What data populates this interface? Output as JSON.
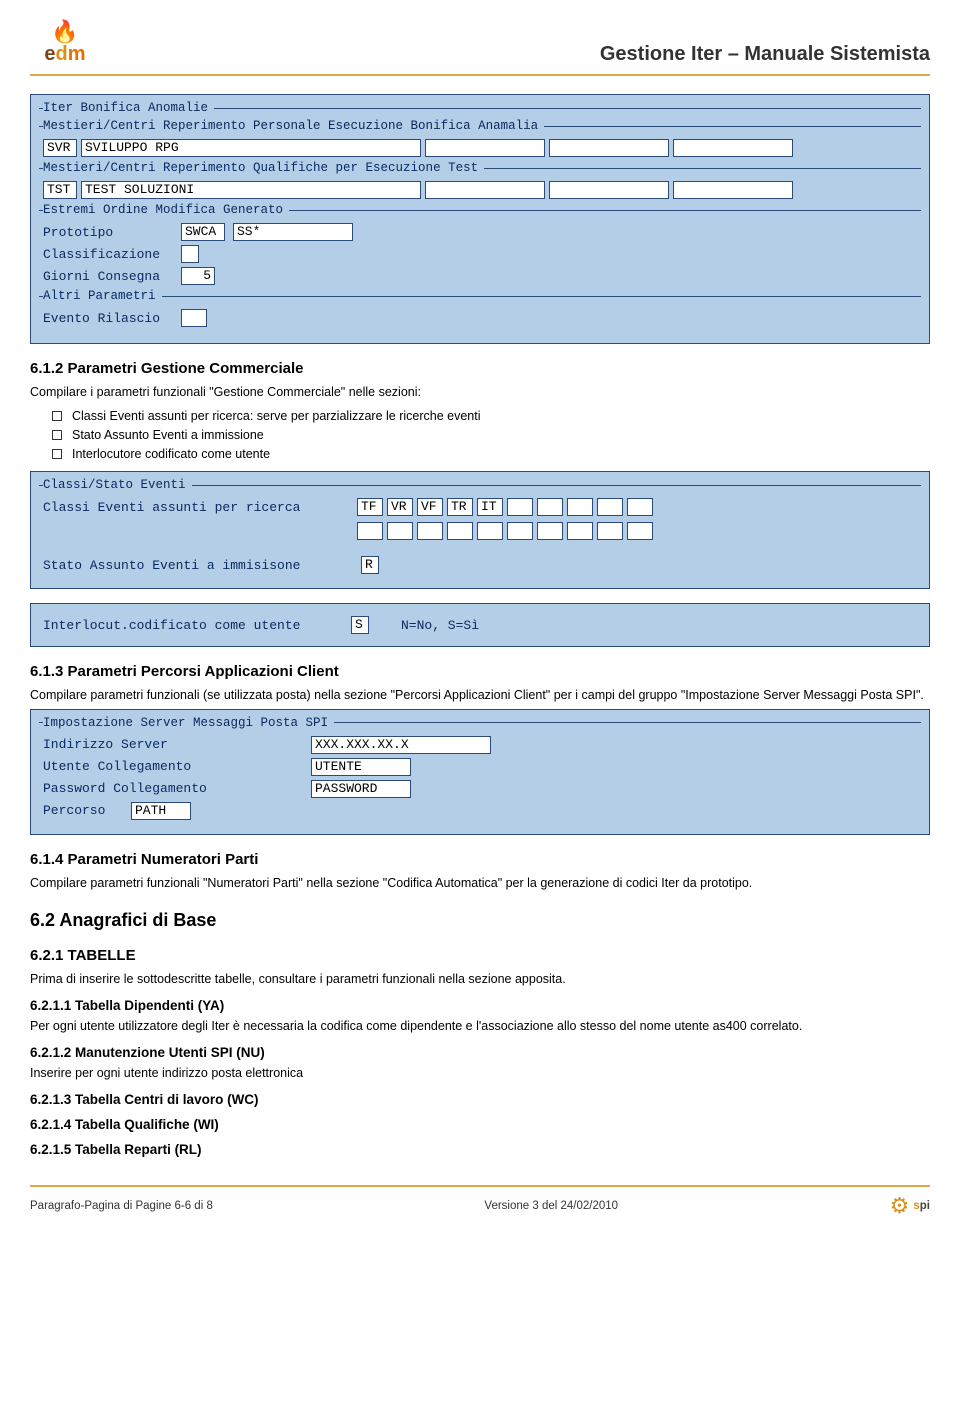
{
  "header": {
    "doc_title": "Gestione Iter – Manuale Sistemista",
    "logo_e": "e",
    "logo_d": "d",
    "logo_m": "m"
  },
  "panel1": {
    "title": "Iter Bonifica Anomalie",
    "g1_legend": "Mestieri/Centri Reperimento Personale Esecuzione Bonifica Anamalia",
    "g1_code": "SVR",
    "g1_desc": "SVILUPPO RPG",
    "g2_legend": "Mestieri/Centri Reperimento Qualifiche per Esecuzione Test",
    "g2_code": "TST",
    "g2_desc": "TEST SOLUZIONI",
    "g3_legend": "Estremi Ordine Modifica Generato",
    "g3_proto_lbl": "Prototipo",
    "g3_proto_val1": "SWCA",
    "g3_proto_val2": "SS*",
    "g3_class_lbl": "Classificazione",
    "g3_days_lbl": "Giorni Consegna",
    "g3_days_val": "5",
    "g4_legend": "Altri Parametri",
    "g4_evt_lbl": "Evento Rilascio"
  },
  "s612": {
    "heading": "6.1.2  Parametri Gestione Commerciale",
    "intro": "Compilare i parametri funzionali \"Gestione Commerciale\" nelle sezioni:",
    "b1": "Classi Eventi assunti per ricerca: serve per parzializzare le ricerche eventi",
    "b2": "Stato Assunto Eventi a immissione",
    "b3": "Interlocutore codificato come utente"
  },
  "panel2": {
    "title": "Classi/Stato Eventi",
    "row1_lbl": "Classi Eventi assunti per ricerca",
    "row1_v1": "TF",
    "row1_v2": "VR",
    "row1_v3": "VF",
    "row1_v4": "TR",
    "row1_v5": "IT",
    "row2_lbl": "Stato Assunto Eventi a immisisone",
    "row2_v": "R"
  },
  "panel3": {
    "lbl": "Interlocut.codificato come utente",
    "val": "S",
    "hint": "N=No, S=Sì"
  },
  "s613": {
    "heading": "6.1.3  Parametri Percorsi Applicazioni Client",
    "body": "Compilare parametri funzionali (se utilizzata posta) nella sezione \"Percorsi Applicazioni Client\" per i campi del gruppo \"Impostazione Server Messaggi Posta SPI\"."
  },
  "panel4": {
    "title": "Impostazione Server Messaggi Posta SPI",
    "r1_lbl": "Indirizzo Server",
    "r1_val": "XXX.XXX.XX.X",
    "r2_lbl": "Utente Collegamento",
    "r2_val": "UTENTE",
    "r3_lbl": "Password Collegamento",
    "r3_val": "PASSWORD",
    "r4_lbl": "Percorso",
    "r4_val": "PATH"
  },
  "s614": {
    "heading": "6.1.4  Parametri Numeratori Parti",
    "body": "Compilare parametri funzionali \"Numeratori Parti\" nella sezione \"Codifica Automatica\" per la generazione di codici Iter da prototipo."
  },
  "s62": {
    "heading": "6.2  Anagrafici di Base",
    "h621": "6.2.1  TABELLE",
    "p621": "Prima di inserire le sottodescritte tabelle, consultare i parametri funzionali nella sezione apposita.",
    "h6211": "6.2.1.1   Tabella Dipendenti (YA)",
    "p6211": "Per ogni utente utilizzatore degli Iter è necessaria la codifica come dipendente e l'associazione allo stesso del nome utente as400 correlato.",
    "h6212": "6.2.1.2   Manutenzione Utenti SPI  (NU)",
    "p6212": "Inserire per ogni utente indirizzo posta elettronica",
    "h6213": "6.2.1.3   Tabella Centri di lavoro (WC)",
    "h6214": "6.2.1.4   Tabella Qualifiche (WI)",
    "h6215": "6.2.1.5   Tabella Reparti (RL)"
  },
  "footer": {
    "left": "Paragrafo-Pagina di Pagine 6-6 di 8",
    "center": "Versione 3 del 24/02/2010",
    "spi_s": "s",
    "spi_pi": "pi"
  }
}
